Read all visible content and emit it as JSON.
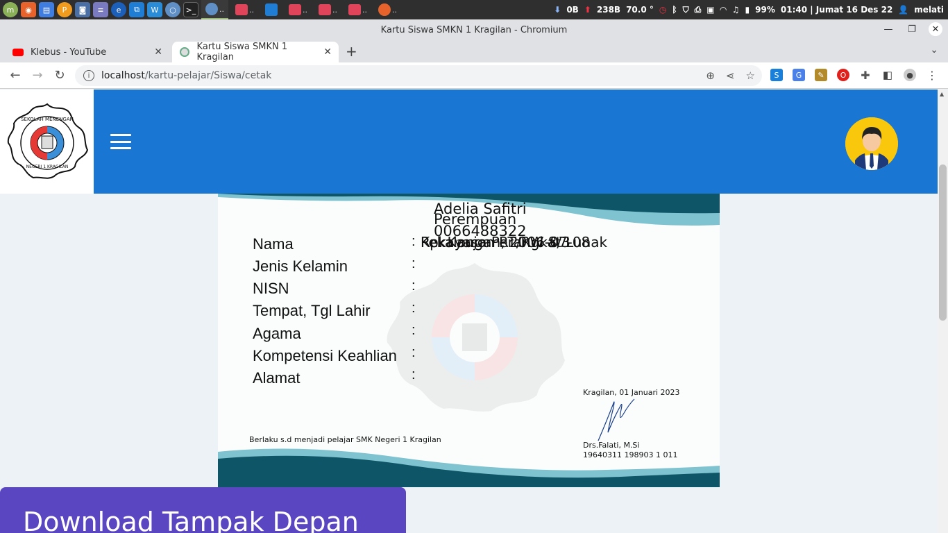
{
  "os_panel": {
    "tasks": [
      "..",
      " ..",
      "..",
      " ..",
      "..",
      " ..",
      " .."
    ],
    "net_down": "0B",
    "net_up": "238B",
    "temperature": "70.0 °",
    "battery": "99%",
    "clock": "01:40 | Jumat 16 Des 22",
    "user": "melati"
  },
  "window": {
    "title": "Kartu Siswa SMKN 1 Kragilan - Chromium"
  },
  "tabs": [
    {
      "label": "Klebus - YouTube"
    },
    {
      "label": "Kartu Siswa SMKN 1 Kragilan"
    }
  ],
  "address": {
    "host": "localhost",
    "path": "/kartu-pelajar/Siswa/cetak"
  },
  "card": {
    "labels": [
      "Nama",
      "Jenis Kelamin",
      "NISN",
      "Tempat, Tgl Lahir",
      "Agama",
      "Kompetensi Keahlian",
      "Alamat"
    ],
    "colon": ":",
    "values": {
      "nama": "Adelia Safitri",
      "jenis_kelamin": "Perempuan",
      "nisn": "0066488322",
      "overlap_1": "Pekalongan, 2006-07-08",
      "overlap_2": "Rekayasa Perangkat Lunak",
      "overlap_3": "Kp. Kaujon RT/RW 8/3"
    },
    "place_date": "Kragilan, 01 Januari 2023",
    "validity": "Berlaku s.d menjadi  pelajar SMK Negeri 1 Kragilan",
    "signer_name": "Drs.Falati, M.Si",
    "signer_nip": "19640311 198903 1 011"
  },
  "download_button": "Download Tampak Depan",
  "colors": {
    "header_blue": "#1976d2",
    "button_purple": "#5b46c2",
    "card_wave_dark": "#0e5568",
    "card_wave_light": "#7ec3cf",
    "avatar_yellow": "#f9c70c"
  }
}
